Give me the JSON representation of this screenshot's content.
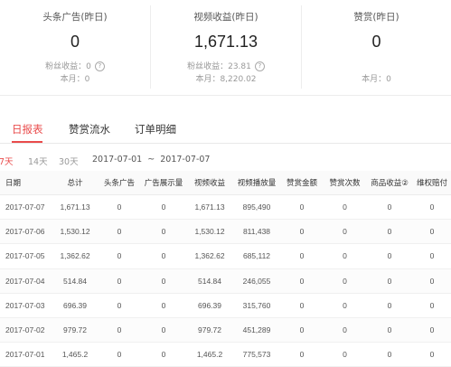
{
  "stats": [
    {
      "label": "头条广告(昨日)",
      "value": "0",
      "sub1": "粉丝收益：0",
      "sub1_help": "?",
      "sub2": "本月：0"
    },
    {
      "label": "视频收益(昨日)",
      "value": "1,671.13",
      "sub1": "粉丝收益：23.81",
      "sub1_help": "?",
      "sub2": "本月：8,220.02"
    },
    {
      "label": "赞赏(昨日)",
      "value": "0",
      "sub2": "本月：0"
    }
  ],
  "tabs": [
    {
      "label": "日报表",
      "active": true
    },
    {
      "label": "赞赏流水",
      "active": false
    },
    {
      "label": "订单明细",
      "active": false
    }
  ],
  "filters": {
    "ranges": [
      "7天",
      "14天",
      "30天"
    ],
    "active_range": "7天",
    "date_from": "2017-07-01",
    "date_sep": "~",
    "date_to": "2017-07-07"
  },
  "table": {
    "headers": [
      "日期",
      "总计",
      "头条广告",
      "广告展示量",
      "视频收益",
      "视频播放量",
      "赞赏金额",
      "赞赏次数",
      "商品收益②",
      "维权赔付"
    ],
    "rows": [
      [
        "2017-07-07",
        "1,671.13",
        "0",
        "0",
        "1,671.13",
        "895,490",
        "0",
        "0",
        "0",
        "0"
      ],
      [
        "2017-07-06",
        "1,530.12",
        "0",
        "0",
        "1,530.12",
        "811,438",
        "0",
        "0",
        "0",
        "0"
      ],
      [
        "2017-07-05",
        "1,362.62",
        "0",
        "0",
        "1,362.62",
        "685,112",
        "0",
        "0",
        "0",
        "0"
      ],
      [
        "2017-07-04",
        "514.84",
        "0",
        "0",
        "514.84",
        "246,055",
        "0",
        "0",
        "0",
        "0"
      ],
      [
        "2017-07-03",
        "696.39",
        "0",
        "0",
        "696.39",
        "315,760",
        "0",
        "0",
        "0",
        "0"
      ],
      [
        "2017-07-02",
        "979.72",
        "0",
        "0",
        "979.72",
        "451,289",
        "0",
        "0",
        "0",
        "0"
      ],
      [
        "2017-07-01",
        "1,465.2",
        "0",
        "0",
        "1,465.2",
        "775,573",
        "0",
        "0",
        "0",
        "0"
      ]
    ]
  },
  "colors": {
    "accent": "#e94b4b"
  }
}
